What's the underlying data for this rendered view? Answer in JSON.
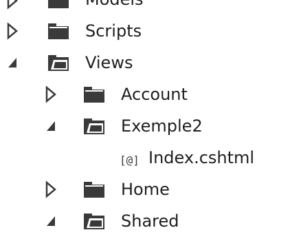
{
  "tree": {
    "items": [
      {
        "label": "Models",
        "state": "collapsed",
        "type": "folder"
      },
      {
        "label": "Scripts",
        "state": "collapsed",
        "type": "folder"
      },
      {
        "label": "Views",
        "state": "expanded",
        "type": "folder-open"
      },
      {
        "label": "Account",
        "state": "collapsed",
        "type": "folder"
      },
      {
        "label": "Exemple2",
        "state": "expanded",
        "type": "folder-open"
      },
      {
        "label": "Index.cshtml",
        "state": "none",
        "type": "razor-file",
        "icon_text": "[@]"
      },
      {
        "label": "Home",
        "state": "collapsed",
        "type": "folder"
      },
      {
        "label": "Shared",
        "state": "expanded",
        "type": "folder-open"
      }
    ]
  },
  "colors": {
    "text": "#1e1e1e",
    "icon": "#3a3a3a",
    "background": "#ffffff"
  }
}
